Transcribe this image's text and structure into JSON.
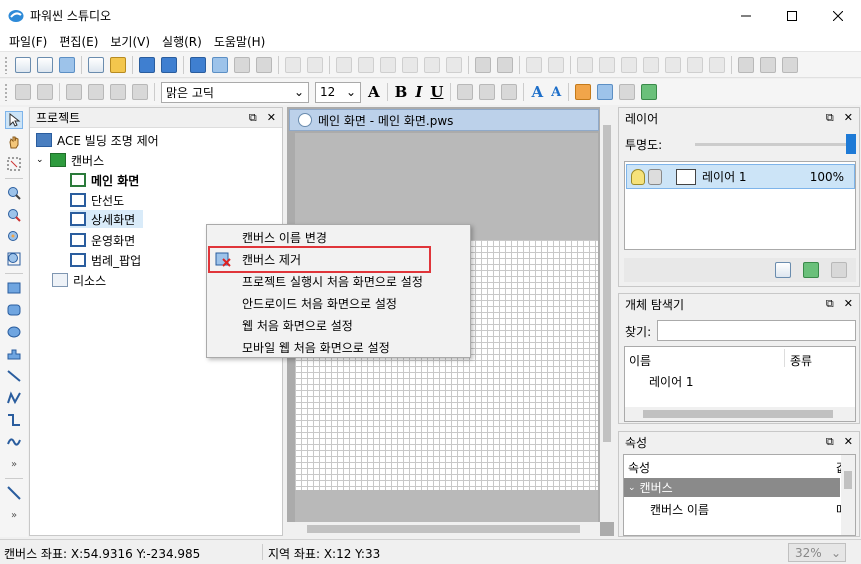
{
  "window": {
    "title": "파워씬 스튜디오"
  },
  "menu": [
    "파일(F)",
    "편집(E)",
    "보기(V)",
    "실행(R)",
    "도움말(H)"
  ],
  "format_toolbar": {
    "font_name": "맑은 고딕",
    "font_size": "12",
    "bold": "B",
    "italic": "I",
    "underline": "U",
    "font_grow": "A",
    "font_shrink": "A"
  },
  "project_panel": {
    "title": "프로젝트",
    "root": "ACE 빌딩 조명 제어",
    "canvas_folder": "캔버스",
    "canvases": [
      "메인 화면",
      "단선도",
      "상세화면",
      "운영화면",
      "범례_팝업"
    ],
    "resources": "리소스"
  },
  "document": {
    "tab_title": "메인 화면 - 메인 화면.pws"
  },
  "context_menu": {
    "items": [
      "캔버스 이름 변경",
      "캔버스 제거",
      "프로젝트 실행시 처음 화면으로 설정",
      "안드로이드 처음 화면으로 설정",
      "웹 처음 화면으로 설정",
      "모바일 웹 처음 화면으로 설정"
    ],
    "highlighted_index": 1
  },
  "layer_panel": {
    "title": "레이어",
    "opacity_label": "투명도:",
    "opacity_value": 1.0,
    "layer_name": "레이어 1",
    "layer_opacity": "100%"
  },
  "explorer_panel": {
    "title": "개체 탐색기",
    "find_label": "찾기:",
    "col_name": "이름",
    "col_type": "종류",
    "row_name": "레이어 1"
  },
  "props_panel": {
    "title": "속성",
    "col_prop": "속성",
    "col_value_clip": "값",
    "category": "캔버스",
    "row_name": "캔버스 이름",
    "row_value_clip": "메"
  },
  "status": {
    "canvas_coord": "캔버스 좌표: X:54.9316 Y:-234.985",
    "region_coord": "지역 좌표: X:12 Y:33",
    "zoom": "32%"
  },
  "colors": {
    "selection": "#cce4f7",
    "highlight_border": "#e0353a",
    "accent": "#1e7ad6"
  }
}
